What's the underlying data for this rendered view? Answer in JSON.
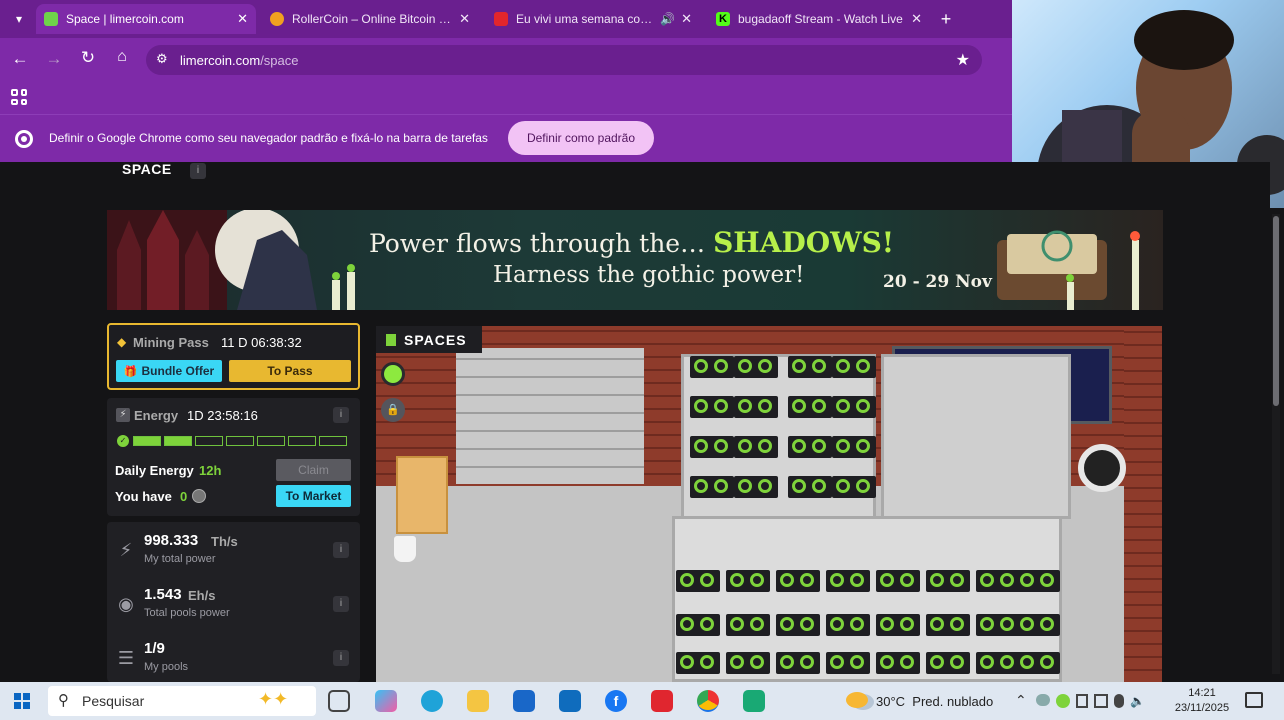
{
  "browser": {
    "tabs": [
      {
        "title": "Space | limercoin.com",
        "active": true,
        "favicon_color": "#6fd34a"
      },
      {
        "title": "RollerCoin – Online Bitcoin Min",
        "active": false,
        "favicon_color": "#f0a020"
      },
      {
        "title": "Eu vivi uma semana como u",
        "active": false,
        "favicon_color": "#e3262c"
      },
      {
        "title": "bugadaoff Stream - Watch Live",
        "active": false,
        "favicon_color": "#53fc18"
      }
    ],
    "url_host": "limercoin.com",
    "url_path": "/space",
    "infobar_text": "Definir o Google Chrome como seu navegador padrão e fixá-lo na barra de tarefas",
    "infobar_button": "Definir como padrão"
  },
  "page": {
    "section_title": "SPACE",
    "banner": {
      "line1": "Power flows through the…",
      "line1_emphasis": "SHADOWS!",
      "line2": "Harness the gothic power!",
      "dates": "20 - 29 Nov"
    },
    "mining_pass": {
      "label": "Mining Pass",
      "timer": "11 D 06:38:32",
      "bundle_button": "Bundle Offer",
      "pass_button": "To Pass"
    },
    "energy": {
      "label": "Energy",
      "timer": "1D 23:58:16",
      "filled_segments": 2,
      "total_segments": 7,
      "daily_label": "Daily Energy",
      "daily_value": "12h",
      "claim_button": "Claim",
      "have_label": "You have",
      "have_value": "0",
      "market_button": "To Market"
    },
    "stats": [
      {
        "value": "998.333",
        "unit": "Th/s",
        "caption": "My total power",
        "icon": "bolt-icon"
      },
      {
        "value": "1.543",
        "unit": "Eh/s",
        "caption": "Total pools power",
        "icon": "globe-icon"
      },
      {
        "value": "1/9",
        "unit": "",
        "caption": "My pools",
        "icon": "layers-icon"
      }
    ],
    "spaces_label": "SPACES"
  },
  "taskbar": {
    "search_placeholder": "Pesquisar",
    "weather": "30°C  Pred. nublado",
    "time": "14:21",
    "date": "23/11/2025"
  },
  "colors": {
    "chrome_purple": "#7e2aa8",
    "accent_green": "#7ed33b",
    "gold": "#e8b830",
    "cyan": "#3ad7f5"
  }
}
